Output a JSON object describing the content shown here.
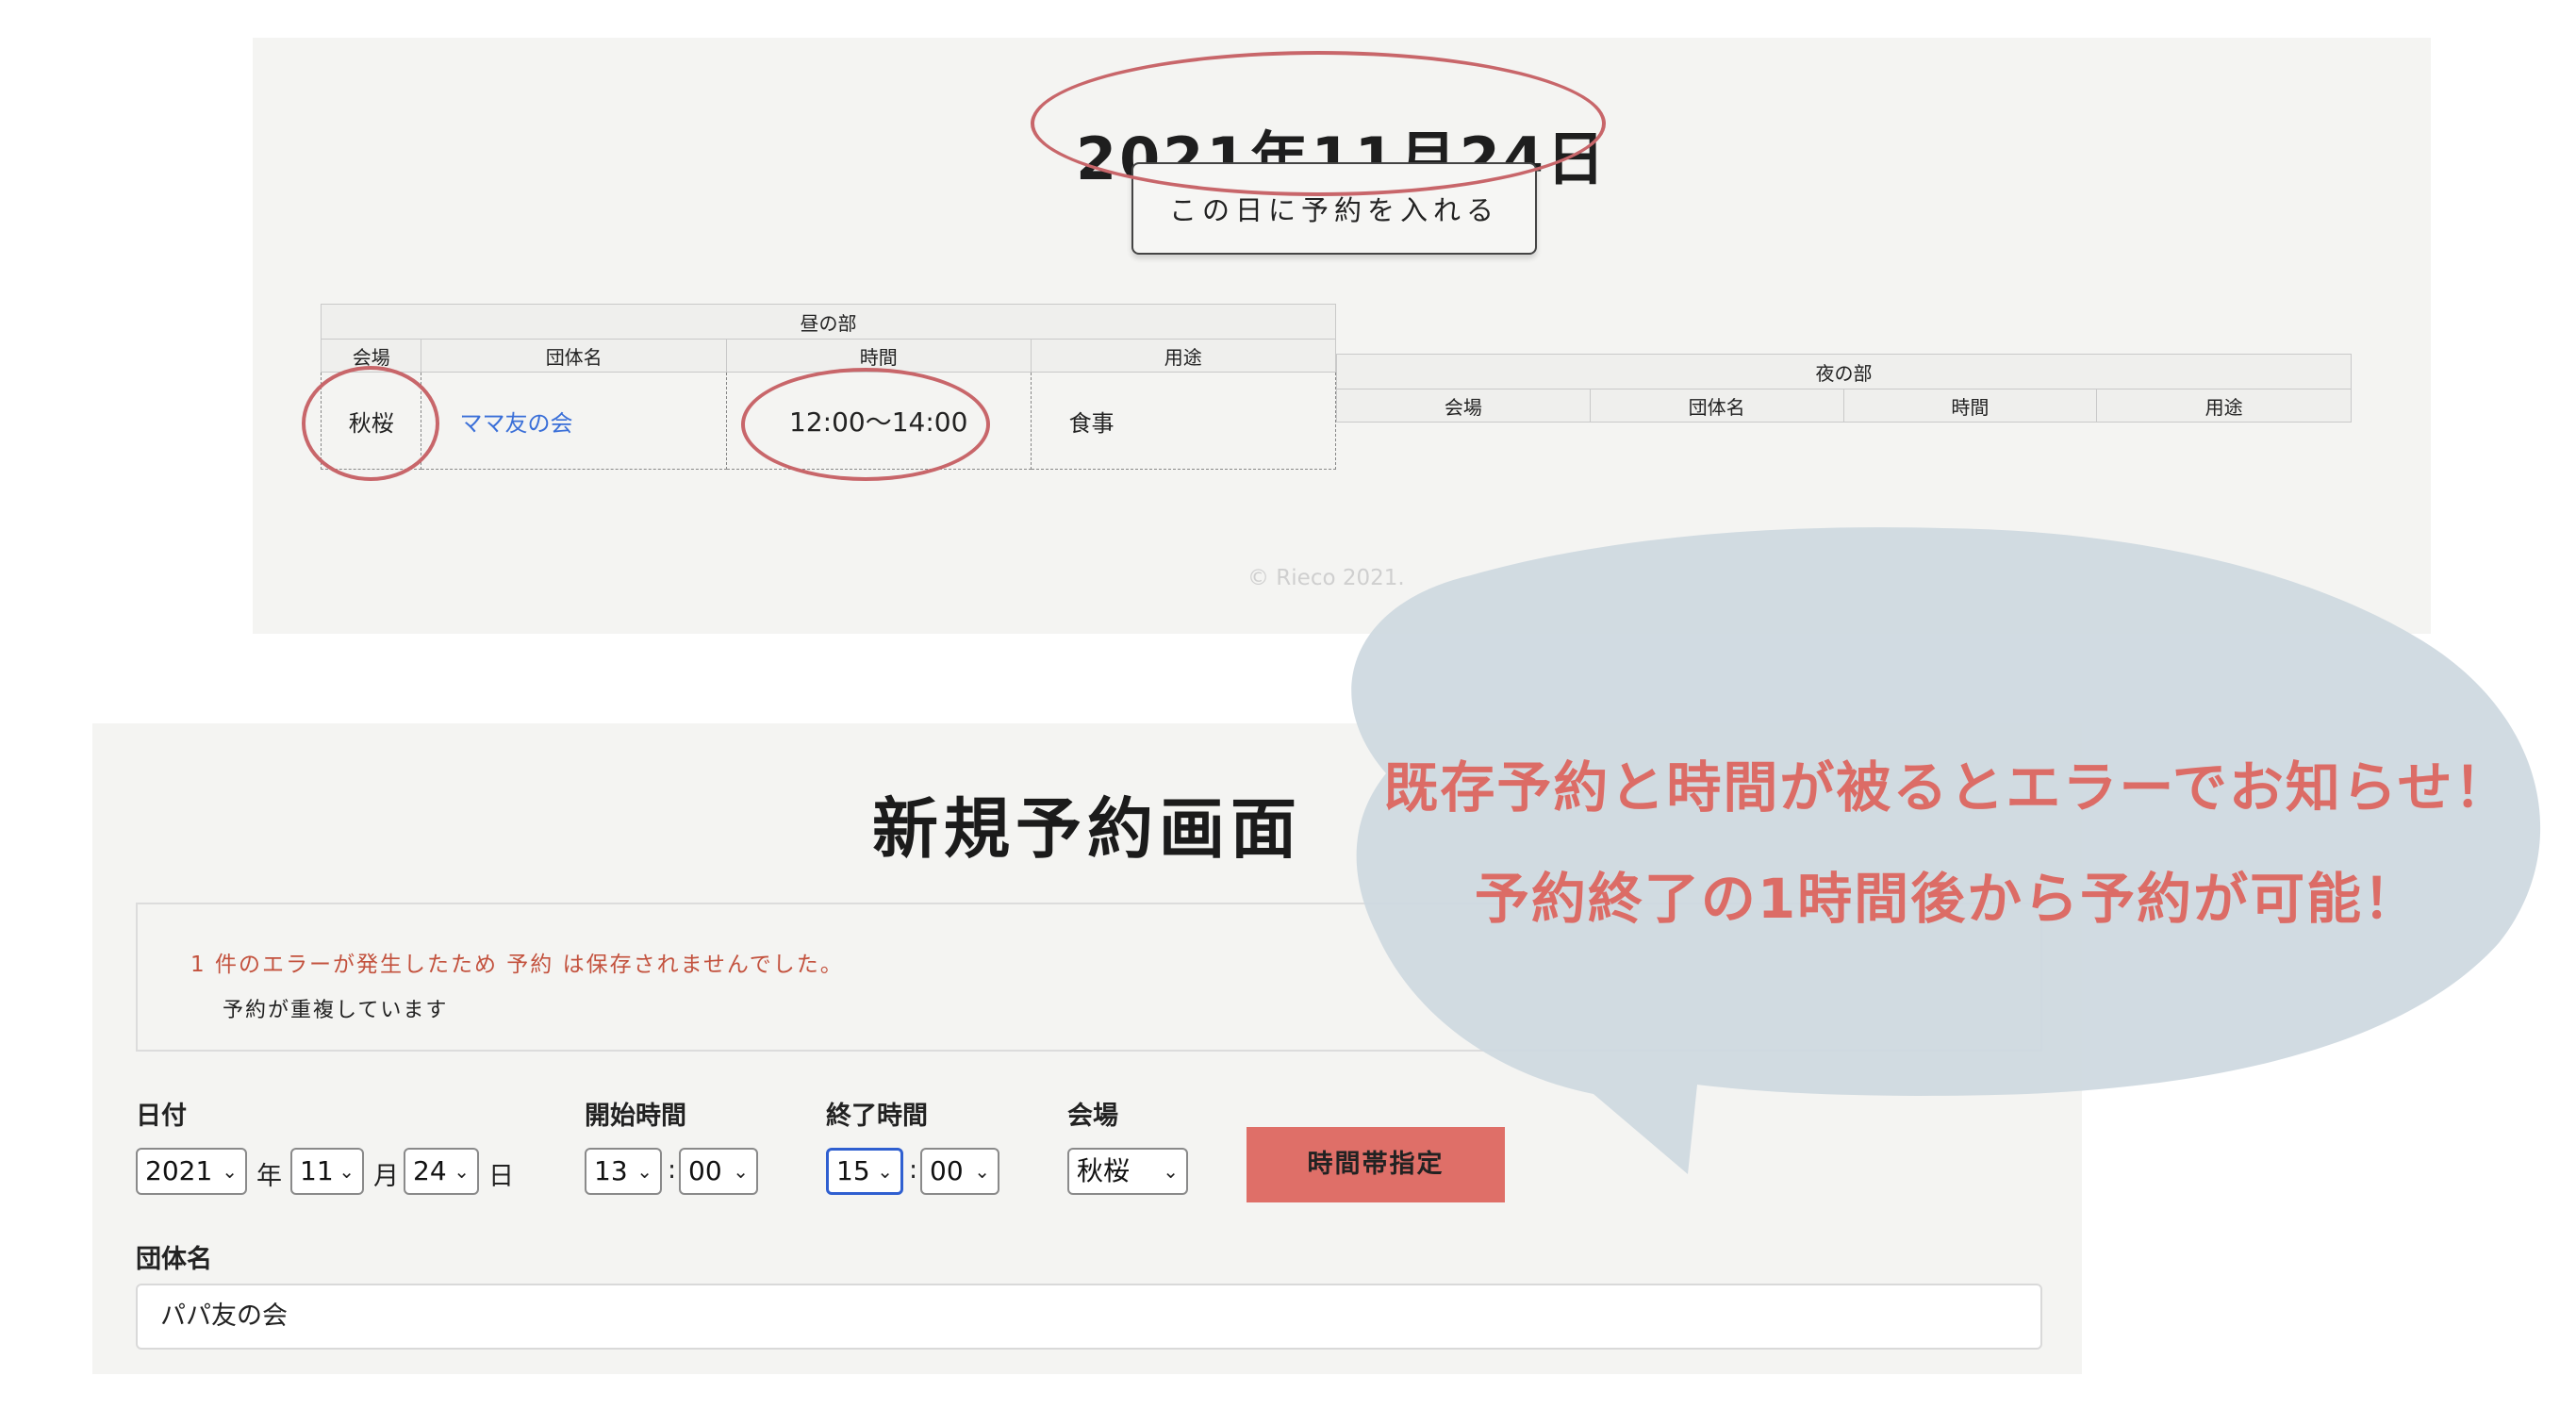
{
  "calendar": {
    "date_title": "2021年11月24日",
    "book_button_label": "この日に予約を入れる",
    "day_section": {
      "title": "昼の部",
      "headers": [
        "会場",
        "団体名",
        "時間",
        "用途"
      ],
      "row": {
        "venue": "秋桜",
        "group": "ママ友の会",
        "time": "12:00〜14:00",
        "purpose": "食事"
      }
    },
    "night_section": {
      "title": "夜の部",
      "headers": [
        "会場",
        "団体名",
        "時間",
        "用途"
      ]
    },
    "copyright": "© Rieco 2021."
  },
  "form": {
    "title": "新規予約画面",
    "error_heading": "1 件のエラーが発生したため 予約 は保存されませんでした。",
    "error_item": "予約が重複しています",
    "date_label": "日付",
    "year_value": "2021",
    "year_unit": "年",
    "month_value": "11",
    "month_unit": "月",
    "day_value": "24",
    "day_unit": "日",
    "start_label": "開始時間",
    "start_hour": "13",
    "start_min": "00",
    "end_label": "終了時間",
    "end_hour": "15",
    "end_min": "00",
    "time_sep": ":",
    "venue_label": "会場",
    "venue_value": "秋桜",
    "time_slot_button": "時間帯指定",
    "group_label": "団体名",
    "group_value": "パパ友の会"
  },
  "callout": {
    "line1": "既存予約と時間が被るとエラーでお知らせ！",
    "line2": "予約終了の1時間後から予約が可能！"
  },
  "colors": {
    "accent_red": "#dc6c66",
    "ring": "#c8666a",
    "bubble": "#cdd8df",
    "link": "#3a6fd8",
    "error_text": "#c3523e",
    "button_bg": "#df6f68"
  }
}
